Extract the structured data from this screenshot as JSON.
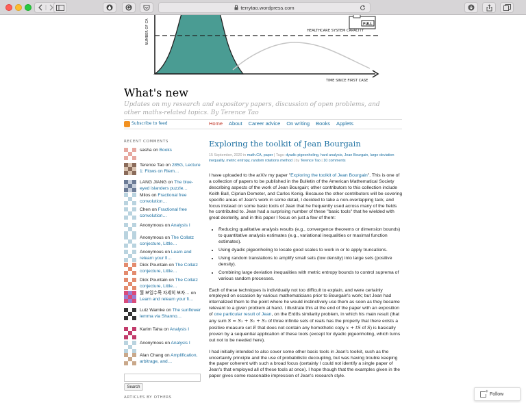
{
  "browser": {
    "url": "terrytao.wordpress.com"
  },
  "header": {
    "graph_labels": {
      "y_axis": "NUMBER OF CA",
      "capacity": "HEALTHCARE SYSTEM CAPACITY",
      "x_axis": "TIME SINCE FIRST CASE",
      "sign": "FULL"
    },
    "site_title": "What's new",
    "tagline": "Updates on my research and expository papers, discussion of open problems, and other maths-related topics. By Terence Tao"
  },
  "nav": {
    "subscribe": "Subscribe to feed",
    "items": [
      "Home",
      "About",
      "Career advice",
      "On writing",
      "Books",
      "Applets"
    ]
  },
  "sidebar": {
    "recent_comments_title": "RECENT COMMENTS",
    "comments": [
      {
        "author": "sasha",
        "on": "on",
        "post": "Books"
      },
      {
        "author": "Terence Tao",
        "on": "on",
        "post": "285G, Lecture 1: Flows on Riem…"
      },
      {
        "author": "LANG JIANG",
        "on": "on",
        "post": "The blue-eyed islanders puzzle…"
      },
      {
        "author": "Milos",
        "on": "on",
        "post": "Fractional free convolution…"
      },
      {
        "author": "Chen",
        "on": "on",
        "post": "Fractional free convolution…"
      },
      {
        "author": "Anonymous",
        "on": "on",
        "post": "Analysis I"
      },
      {
        "author": "Anonymous",
        "on": "on",
        "post": "The Collatz conjecture, Little…"
      },
      {
        "author": "Anonymous",
        "on": "on",
        "post": "Learn and relearn your fi…"
      },
      {
        "author": "Dick Pountain",
        "on": "on",
        "post": "The Collatz conjecture, Little…"
      },
      {
        "author": "Dick Pountain",
        "on": "on",
        "post": "The Collatz conjecture, Little…"
      },
      {
        "author": "월 보잉수목 자세히 보자…",
        "on": "on",
        "post": "Learn and relearn your fi…"
      },
      {
        "author": "Lutz Warnke",
        "on": "on",
        "post": "The sunflower lemma via Shanno…"
      },
      {
        "author": "Karim Taha",
        "on": "on",
        "post": "Analysis I"
      },
      {
        "author": "Anonymous",
        "on": "on",
        "post": "Analysis I"
      },
      {
        "author": "Alan Chang",
        "on": "on",
        "post": "Amplification, arbitrage, and…"
      }
    ],
    "search_button": "Search",
    "articles_title": "ARTICLES BY OTHERS"
  },
  "post": {
    "title": "Exploring the toolkit of Jean Bourgain",
    "date": "15 September, 2020",
    "in": "in",
    "categories": "math.CA, paper",
    "tags_label": "Tags:",
    "tags": "dyadic pigeonholing, hard analysis, Jean Bourgain, large deviation inequality, metric entropy, random rotations method",
    "by": "by",
    "author": "Terence Tao",
    "comments": "10 comments",
    "p1_pre": "I have uploaded to the arXiv my paper \"",
    "p1_link": "Exploring the toolkit of Jean Bourgain",
    "p1_post": "\". This is one of a collection of papers to be published in the Bulletin of the American Mathematical Society describing aspects of the work of Jean Bourgain; other contributors to this collection include Keith Ball, Ciprian Demeter, and Carlos Kenig. Because the other contributors will be covering specific areas of Jean's work in some detail, I decided to take a non-overlapping tack, and focus instead on some basic tools of Jean that he frequently used across many of the fields he contributed to. Jean had a surprising number of these \"basic tools\" that he wielded with great dexterity, and in this paper I focus on just a few of them:",
    "bullets": [
      "Reducing qualitative analysis results (e.g., convergence theorems or dimension bounds) to quantitative analysis estimates (e.g., variational inequalities or maximal function estimates).",
      "Using dyadic pigeonholing to locate good scales to work in or to apply truncations.",
      "Using random translations to amplify small sets (low density) into large sets (positive density).",
      "Combining large deviation inequalities with metric entropy bounds to control suprema of various random processes."
    ],
    "p2_a": "Each of these techniques is individually not too difficult to explain, and were certainly employed on occasion by various mathematicians prior to Bourgain's work; but Jean had internalized them to the point where he would instinctively use them as soon as they became relevant to a given problem at hand. I illustrate this at the end of the paper with an exposition of ",
    "p2_link": "one particular result of Jean",
    "p2_b": ", on the Erdős similarity problem, in which his main result (that any sum ",
    "p2_math1": "S = S₁ + S₂ + S₃",
    "p2_c": " of three infinite sets of reals has the property that there exists a positive measure set ",
    "p2_math2": "E",
    "p2_d": " that does not contain any homothetic copy ",
    "p2_math3": "x + tS",
    "p2_e": " of ",
    "p2_math4": "S",
    "p2_f": ") is basically proven by a sequential application of these tools (except for dyadic pigeonholing, which turns out not to be needed here).",
    "p3": "I had initially intended to also cover some other basic tools in Jean's toolkit, such as the uncertainty principle and the use of probabilistic decoupling, but was having trouble keeping the paper coherent with such a broad focus (certainly I could not identify a single paper of Jean's that employed all of these tools at once). I hope though that the examples given in the paper gives some reasonable impression of Jean's research style."
  },
  "follow_button": "Follow"
}
